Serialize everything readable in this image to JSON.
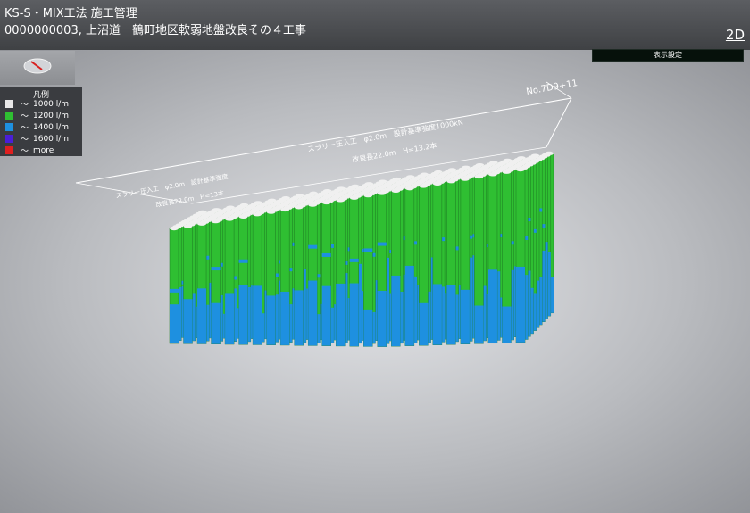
{
  "header": {
    "app_title": "KS-S・MIX工法 施工管理",
    "project": "0000000003, 上沼道　鶴町地区軟弱地盤改良その４工事",
    "mode_toggle": "2D",
    "settings_label": "表示設定"
  },
  "legend": {
    "title": "凡例",
    "items": [
      {
        "tilde": "～",
        "label": "1000 l/m",
        "color": "#e8e8e8"
      },
      {
        "tilde": "～",
        "label": "1200 l/m",
        "color": "#2fbf32"
      },
      {
        "tilde": "～",
        "label": "1400 l/m",
        "color": "#1e90e0"
      },
      {
        "tilde": "～",
        "label": "1600 l/m",
        "color": "#4a1ed8"
      },
      {
        "tilde": "～",
        "label": "more",
        "color": "#e02020"
      }
    ]
  },
  "scene": {
    "labels": {
      "plan_name": "No.7D9+11",
      "line1": "スラリー圧入工　φ2.0m　設計基準強度1000kN",
      "line2": "改良長22.0m　H=13.2本",
      "line3": "スラリー圧入工　φ2.0m　設計基準強度",
      "line4": "改良長22.0m　H=13本"
    },
    "column_colors": {
      "green": "#2fbf32",
      "blue": "#1e90e0",
      "cap": "#f0f0f0"
    }
  }
}
